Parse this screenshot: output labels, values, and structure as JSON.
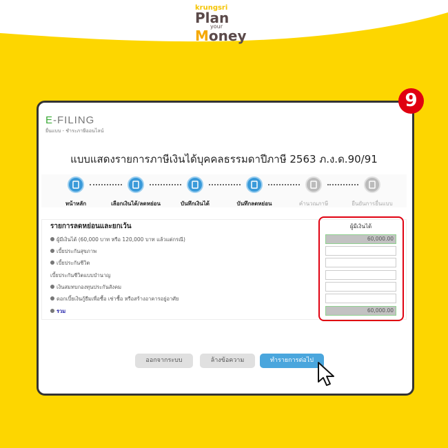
{
  "brand": {
    "krungsri": "krungsri",
    "plan": "Plan",
    "your": "your",
    "money_m": "M",
    "money_rest": "oney"
  },
  "badge": "9",
  "efiling": {
    "logo_e": "E",
    "logo_rest": "-FILING",
    "subtitle": "ยื่นแบบ - ชำระภาษีออนไลน์"
  },
  "title": "แบบแสดงรายการภาษีเงินได้บุคคลธรรมดาปีภาษี 2563 ภ.ง.ด.90/91",
  "steps": [
    {
      "label": "หน้าหลัก",
      "active": true,
      "icon": "home-icon"
    },
    {
      "label": "เลือกเงินได้/ลดหย่อน",
      "active": true,
      "icon": "edit-form-icon"
    },
    {
      "label": "บันทึกเงินได้",
      "active": true,
      "icon": "edit-form-icon"
    },
    {
      "label": "บันทึกลดหย่อน",
      "active": true,
      "icon": "edit-form-icon"
    },
    {
      "label": "คำนวณภาษี",
      "active": false,
      "icon": "calculate-icon"
    },
    {
      "label": "ยืนยันการยื่นแบบ",
      "active": false,
      "icon": "confirm-icon"
    }
  ],
  "deductions": {
    "header": "รายการลดหย่อนและยกเว้น",
    "column": "ผู้มีเงินได้",
    "rows": [
      {
        "label": "ผู้มีเงินได้ (60,000 บาท หรือ 120,000 บาท แล้วแต่กรณี)",
        "value": "60,000.00",
        "bullet": true,
        "readonly": true
      },
      {
        "label": "เบี้ยประกันสุขภาพ",
        "value": "",
        "bullet": true,
        "readonly": false
      },
      {
        "label": "เบี้ยประกันชีวิต",
        "value": "",
        "bullet": true,
        "readonly": false
      },
      {
        "label": "เบี้ยประกันชีวิตแบบบำนาญ",
        "value": "",
        "bullet": false,
        "readonly": false
      },
      {
        "label": "เงินสมทบกองทุนประกันสังคม",
        "value": "",
        "bullet": true,
        "readonly": false
      },
      {
        "label": "ดอกเบี้ยเงินกู้ยืมเพื่อซื้อ เช่าซื้อ หรือสร้างอาคารอยู่อาศัย",
        "value": "",
        "bullet": true,
        "readonly": false
      },
      {
        "label": "รวม",
        "value": "60,000.00",
        "bullet": true,
        "readonly": true,
        "total": true
      }
    ]
  },
  "buttons": {
    "logout": "ออกจากระบบ",
    "clear": "ล้างข้อความ",
    "next": "ทำรายการต่อไป"
  },
  "colors": {
    "background": "#FDD600",
    "accent": "#4AA6DD",
    "highlight": "#E00010",
    "efiling_green": "#3AAA35"
  }
}
